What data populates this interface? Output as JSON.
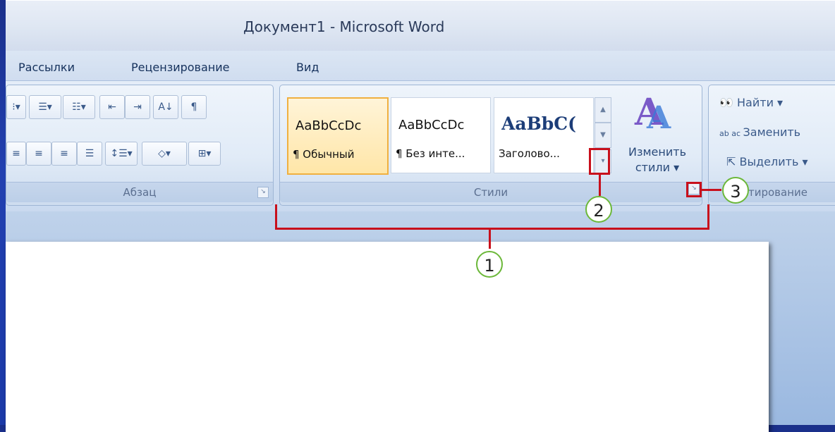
{
  "window": {
    "title": "Документ1 - Microsoft Word"
  },
  "tabs": [
    "Рассылки",
    "Рецензирование",
    "Вид"
  ],
  "paragraph_group": {
    "label": "Абзац"
  },
  "styles_group": {
    "label": "Стили",
    "tiles": [
      {
        "sample": "AaBbCcDc",
        "name": "¶ Обычный"
      },
      {
        "sample": "AaBbCcDc",
        "name": "¶ Без инте..."
      },
      {
        "sample": "AaBbC(",
        "name": "Заголово..."
      }
    ],
    "change_styles_line1": "Изменить",
    "change_styles_line2": "стили ▾"
  },
  "editing_group": {
    "find": "Найти ▾",
    "replace": "Заменить",
    "select": "Выделить ▾",
    "label": "тирование"
  },
  "callouts": {
    "one": "1",
    "two": "2",
    "three": "3"
  },
  "colors": {
    "callout_border": "#6cb83a",
    "highlight": "#c8101c"
  }
}
